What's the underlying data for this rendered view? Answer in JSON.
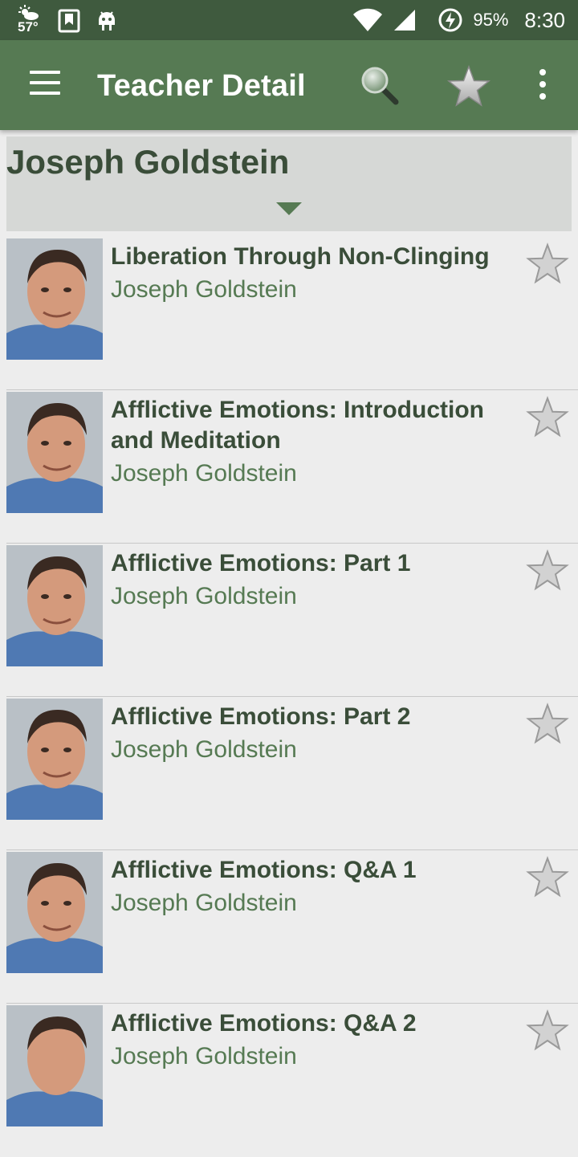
{
  "status_bar": {
    "temperature": "57°",
    "battery_percent": "95%",
    "time": "8:30",
    "icons": [
      "weather-icon",
      "bookmark-notification-icon",
      "android-debug-icon",
      "wifi-icon",
      "signal-icon",
      "battery-charging-icon"
    ]
  },
  "app_bar": {
    "title": "Teacher Detail",
    "icons": [
      "menu-icon",
      "search-icon",
      "star-icon",
      "overflow-icon"
    ]
  },
  "teacher": {
    "name": "Joseph Goldstein"
  },
  "talks": [
    {
      "title": "Liberation Through Non-Clinging",
      "author": "Joseph Goldstein"
    },
    {
      "title": "Afflictive Emotions: Introduction and Meditation",
      "author": "Joseph Goldstein"
    },
    {
      "title": "Afflictive Emotions: Part 1",
      "author": "Joseph Goldstein"
    },
    {
      "title": "Afflictive Emotions: Part 2",
      "author": "Joseph Goldstein"
    },
    {
      "title": "Afflictive Emotions: Q&A 1",
      "author": "Joseph Goldstein"
    },
    {
      "title": "Afflictive Emotions: Q&A 2",
      "author": "Joseph Goldstein"
    }
  ],
  "colors": {
    "status_bar": "#3f5a3e",
    "app_bar": "#567a53",
    "header_bg": "#d6d8d6",
    "title_text": "#3a4d39",
    "author_text": "#567a53",
    "background": "#ededed"
  }
}
